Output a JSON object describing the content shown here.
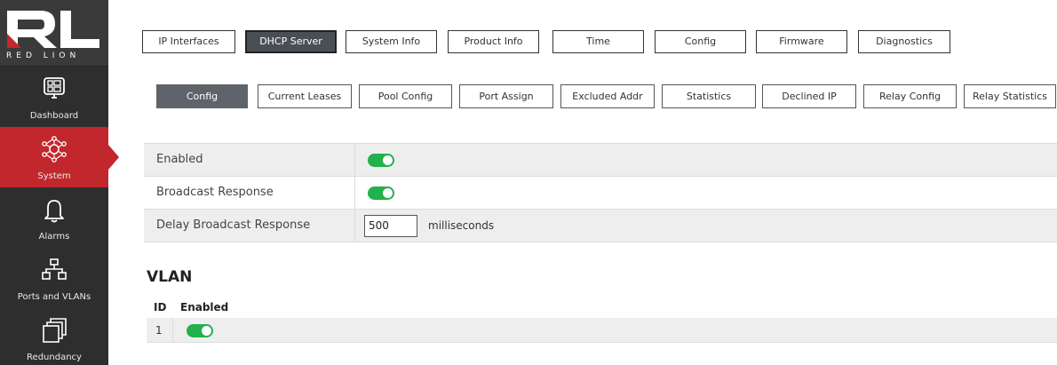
{
  "brand": {
    "name": "RED LION",
    "logo_letters": "RL"
  },
  "sidebar": {
    "items": [
      {
        "label": "Dashboard",
        "icon": "dashboard-icon",
        "active": false
      },
      {
        "label": "System",
        "icon": "network-hub-icon",
        "active": true
      },
      {
        "label": "Alarms",
        "icon": "bell-icon",
        "active": false
      },
      {
        "label": "Ports and VLANs",
        "icon": "ports-icon",
        "active": false
      },
      {
        "label": "Redundancy",
        "icon": "stack-icon",
        "active": false
      }
    ]
  },
  "top_tabs": [
    {
      "label": "IP Interfaces",
      "active": false
    },
    {
      "label": "DHCP Server",
      "active": true
    },
    {
      "label": "System Info",
      "active": false
    },
    {
      "label": "Product Info",
      "active": false
    },
    {
      "label": "Time",
      "active": false
    },
    {
      "label": "Config",
      "active": false
    },
    {
      "label": "Firmware",
      "active": false
    },
    {
      "label": "Diagnostics",
      "active": false
    }
  ],
  "sub_tabs": [
    {
      "label": "Config",
      "active": true
    },
    {
      "label": "Current Leases",
      "active": false
    },
    {
      "label": "Pool Config",
      "active": false
    },
    {
      "label": "Port Assign",
      "active": false
    },
    {
      "label": "Excluded Addr",
      "active": false
    },
    {
      "label": "Statistics",
      "active": false
    },
    {
      "label": "Declined IP",
      "active": false
    },
    {
      "label": "Relay Config",
      "active": false
    },
    {
      "label": "Relay Statistics",
      "active": false
    }
  ],
  "settings": {
    "enabled": {
      "label": "Enabled",
      "value": true
    },
    "broadcast_response": {
      "label": "Broadcast Response",
      "value": true
    },
    "delay_broadcast_response": {
      "label": "Delay Broadcast Response",
      "value": "500",
      "unit": "milliseconds"
    }
  },
  "vlan": {
    "title": "VLAN",
    "columns": [
      "ID",
      "Enabled"
    ],
    "rows": [
      {
        "id": "1",
        "enabled": true
      }
    ]
  },
  "colors": {
    "accent": "#c1272d",
    "toggle_on": "#22b14c",
    "sidebar_bg": "#2e2e2e"
  }
}
